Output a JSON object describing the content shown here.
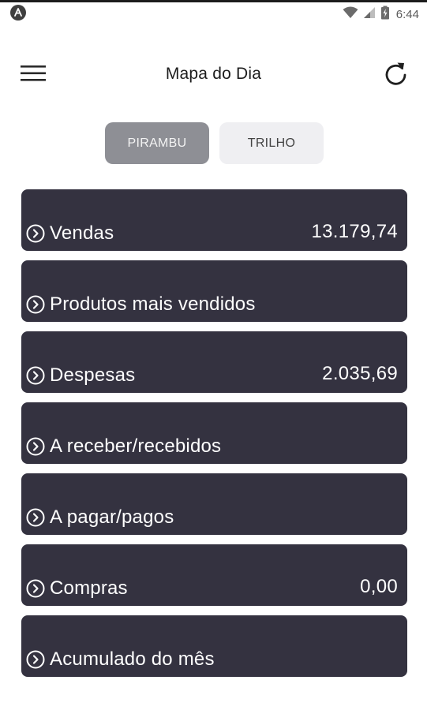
{
  "status_bar": {
    "time": "6:44",
    "icons": [
      "app-logo-icon",
      "wifi-icon",
      "signal-icon",
      "battery-icon"
    ]
  },
  "app_bar": {
    "title": "Mapa do Dia",
    "menu_icon": "hamburger-menu-icon",
    "refresh_icon": "refresh-icon"
  },
  "tabs": [
    {
      "label": "PIRAMBU",
      "selected": true
    },
    {
      "label": "TRILHO",
      "selected": false
    }
  ],
  "cards": [
    {
      "label": "Vendas",
      "value": "13.179,74",
      "icon": "chevron-circle-right-icon"
    },
    {
      "label": "Produtos mais vendidos",
      "value": "",
      "icon": "chevron-circle-right-icon"
    },
    {
      "label": "Despesas",
      "value": "2.035,69",
      "icon": "chevron-circle-right-icon"
    },
    {
      "label": "A receber/recebidos",
      "value": "",
      "icon": "chevron-circle-right-icon"
    },
    {
      "label": "A pagar/pagos",
      "value": "",
      "icon": "chevron-circle-right-icon"
    },
    {
      "label": "Compras",
      "value": "0,00",
      "icon": "chevron-circle-right-icon"
    },
    {
      "label": "Acumulado do mês",
      "value": "",
      "icon": "chevron-circle-right-icon"
    }
  ],
  "colors": {
    "card_background": "#343240",
    "tab_selected": "#8e8f95",
    "tab_unselected": "#efeff2"
  }
}
